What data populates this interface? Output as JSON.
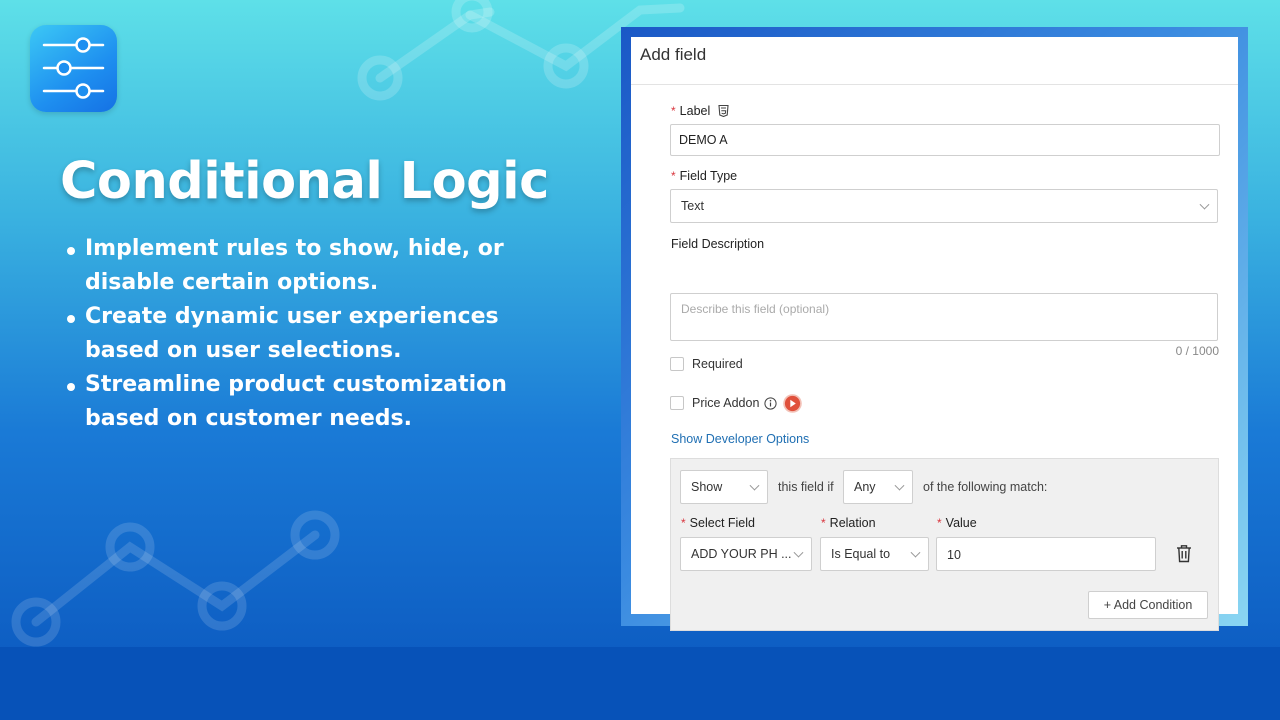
{
  "headline": "Conditional Logic",
  "bullets": [
    "Implement rules to show, hide, or disable certain options.",
    "Create dynamic user experiences based on user selections.",
    "Streamline product customization based on customer needs."
  ],
  "app_icon": "sliders-icon",
  "panel": {
    "title": "Add field",
    "label_field": {
      "label": "Label",
      "required_mark": "*",
      "value": "DEMO A",
      "icon": "html5-icon"
    },
    "field_type": {
      "label": "Field Type",
      "required_mark": "*",
      "value": "Text"
    },
    "field_description": {
      "label": "Field Description",
      "placeholder": "Describe this field (optional)",
      "counter": "0 / 1000"
    },
    "required_checkbox": {
      "label": "Required",
      "checked": false
    },
    "price_addon_checkbox": {
      "label": "Price Addon",
      "checked": false,
      "icons": [
        "info-icon",
        "play-icon"
      ]
    },
    "developer_link": "Show Developer Options",
    "condition": {
      "action": "Show",
      "text_this_field_if": "this field if",
      "match": "Any",
      "text_following": "of the following match:",
      "select_field_label": "Select Field",
      "relation_label": "Relation",
      "value_label": "Value",
      "required_mark": "*",
      "select_field_value": "ADD YOUR PH ...",
      "relation_value": "Is Equal to",
      "value": "10",
      "add_condition": "+ Add Condition"
    }
  },
  "colors": {
    "required": "#d9363e",
    "link": "#1f6fb3",
    "play_button": "#e0513c"
  }
}
